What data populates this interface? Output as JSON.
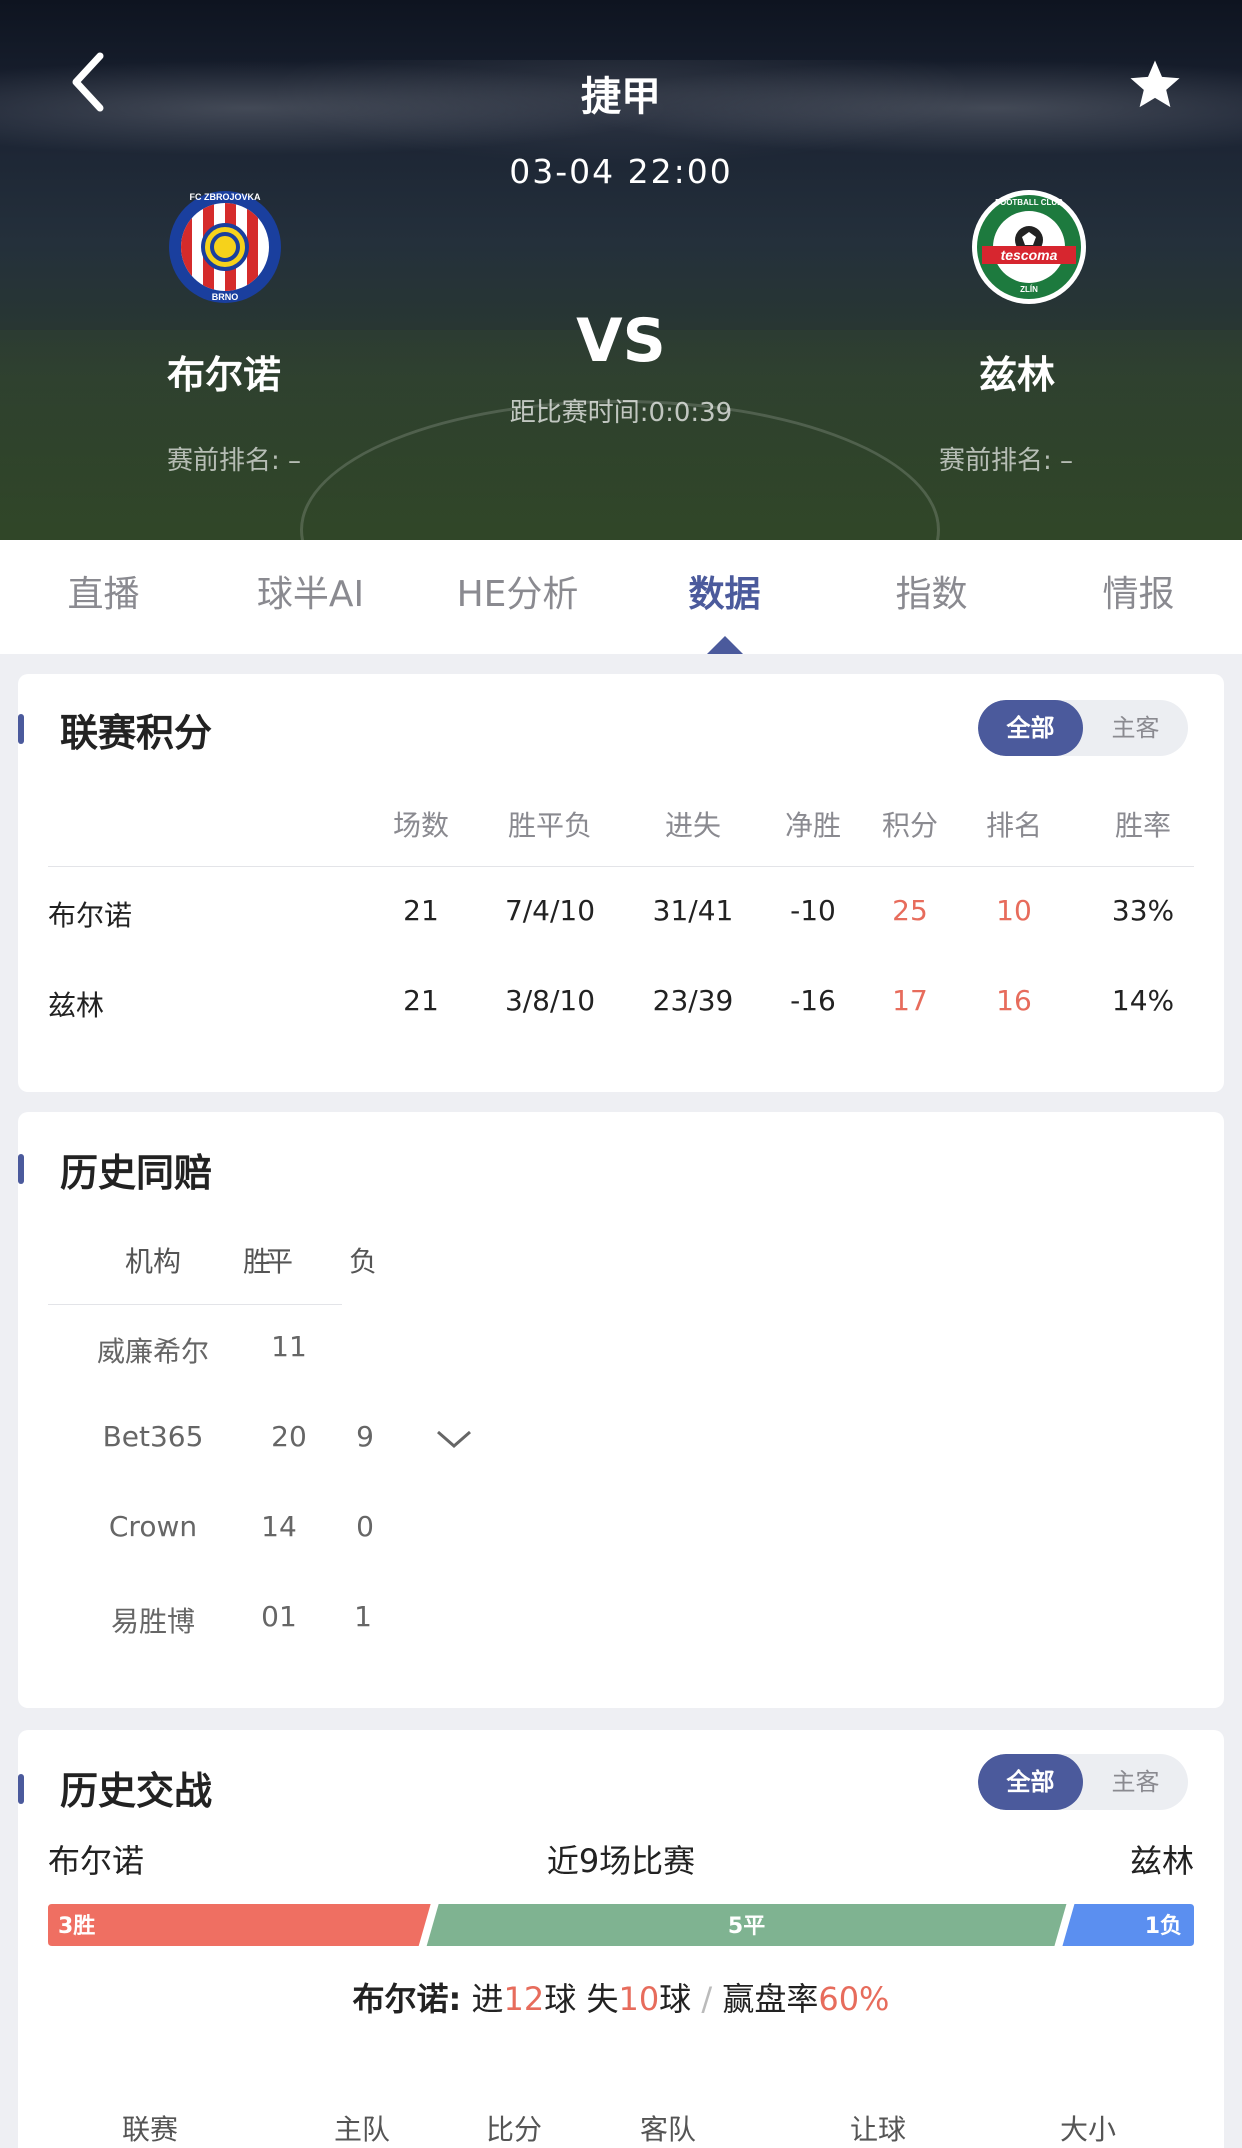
{
  "header": {
    "league": "捷甲",
    "datetime": "03-04 22:00",
    "vs": "VS",
    "countdown": "距比赛时间:0:0:39",
    "home": {
      "name": "布尔诺",
      "rank": "赛前排名: –"
    },
    "away": {
      "name": "兹林",
      "rank": "赛前排名: –"
    },
    "home_badge": {
      "ring": "FC ZBROJOVKA",
      "bottom": "BRNO"
    },
    "away_badge": {
      "ring": "FOOTBALL CLUB",
      "band": "tescoma",
      "bottom": "ZLÍN"
    }
  },
  "tabs": [
    {
      "label": "直播"
    },
    {
      "label": "球半AI"
    },
    {
      "label": "HE分析"
    },
    {
      "label": "数据",
      "active": true
    },
    {
      "label": "指数"
    },
    {
      "label": "情报"
    }
  ],
  "league_table": {
    "title": "联赛积分",
    "toggle": [
      "全部",
      "主客"
    ],
    "headers": [
      "场数",
      "胜平负",
      "进失",
      "净胜",
      "积分",
      "排名",
      "胜率"
    ],
    "rows": [
      {
        "team": "布尔诺",
        "played": "21",
        "wdl": "7/4/10",
        "gf": "31/41",
        "gd": "-10",
        "pts": "25",
        "rank": "10",
        "rate": "33%"
      },
      {
        "team": "兹林",
        "played": "21",
        "wdl": "3/8/10",
        "gf": "23/39",
        "gd": "-16",
        "pts": "17",
        "rank": "16",
        "rate": "14%"
      }
    ]
  },
  "same_odds": {
    "title": "历史同赔",
    "headers": [
      "机构",
      "胜",
      "平",
      "负"
    ],
    "rows": [
      {
        "org": "威廉希尔",
        "a": "11",
        "b": ""
      },
      {
        "org": "Bet365",
        "a": "20",
        "b": "9"
      },
      {
        "org": "Crown",
        "a": "14",
        "b": "0"
      },
      {
        "org": "易胜博",
        "a": "01",
        "b": "1"
      }
    ]
  },
  "h2h": {
    "title": "历史交战",
    "toggle": [
      "全部",
      "主客"
    ],
    "home": "布尔诺",
    "away": "兹林",
    "recent": "近9场比赛",
    "win_label": "3胜",
    "draw_label": "5平",
    "loss_label": "1负",
    "win": 3,
    "draw": 5,
    "loss": 1,
    "summary": {
      "team": "布尔诺:",
      "in_label": "进",
      "goals_for": "12",
      "ball1": "球",
      "out_label": "失",
      "goals_against": "10",
      "ball2": "球",
      "sep": "/",
      "rate_label": "赢盘率",
      "rate": "60%"
    },
    "columns": [
      "联赛",
      "主队",
      "比分",
      "客队",
      "让球",
      "大小"
    ]
  },
  "colors": {
    "accent": "#4b5a9c",
    "red": "#e76c5c",
    "green": "#7fb391",
    "blue": "#5b8ff0",
    "win_bar": "#ef6f62"
  }
}
